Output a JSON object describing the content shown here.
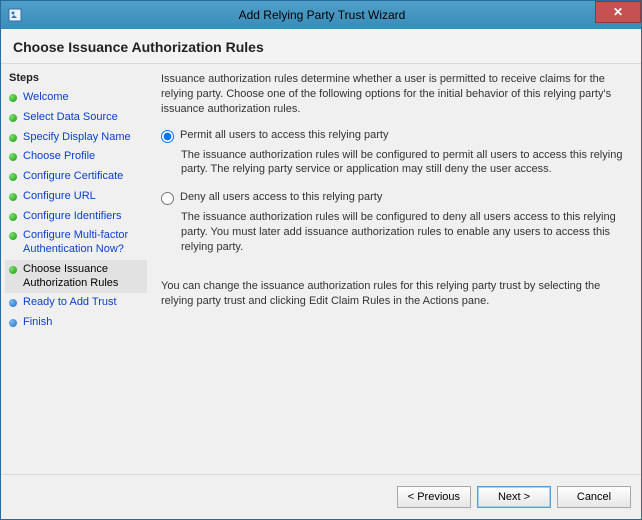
{
  "window": {
    "title": "Add Relying Party Trust Wizard",
    "close": "✕"
  },
  "heading": "Choose Issuance Authorization Rules",
  "sidebar": {
    "title": "Steps",
    "items": [
      {
        "label": "Welcome",
        "state": "done"
      },
      {
        "label": "Select Data Source",
        "state": "done"
      },
      {
        "label": "Specify Display Name",
        "state": "done"
      },
      {
        "label": "Choose Profile",
        "state": "done"
      },
      {
        "label": "Configure Certificate",
        "state": "done"
      },
      {
        "label": "Configure URL",
        "state": "done"
      },
      {
        "label": "Configure Identifiers",
        "state": "done"
      },
      {
        "label": "Configure Multi-factor Authentication Now?",
        "state": "done"
      },
      {
        "label": "Choose Issuance Authorization Rules",
        "state": "active"
      },
      {
        "label": "Ready to Add Trust",
        "state": "pending"
      },
      {
        "label": "Finish",
        "state": "pending"
      }
    ]
  },
  "content": {
    "intro": "Issuance authorization rules determine whether a user is permitted to receive claims for the relying party. Choose one of the following options for the initial behavior of this relying party's issuance authorization rules.",
    "option1": {
      "label": "Permit all users to access this relying party",
      "desc": "The issuance authorization rules will be configured to permit all users to access this relying party. The relying party service or application may still deny the user access.",
      "checked": true
    },
    "option2": {
      "label": "Deny all users access to this relying party",
      "desc": "The issuance authorization rules will be configured to deny all users access to this relying party. You must later add issuance authorization rules to enable any users to access this relying party.",
      "checked": false
    },
    "note": "You can change the issuance authorization rules for this relying party trust by selecting the relying party trust and clicking Edit Claim Rules in the Actions pane."
  },
  "buttons": {
    "previous": "< Previous",
    "next": "Next >",
    "cancel": "Cancel"
  }
}
